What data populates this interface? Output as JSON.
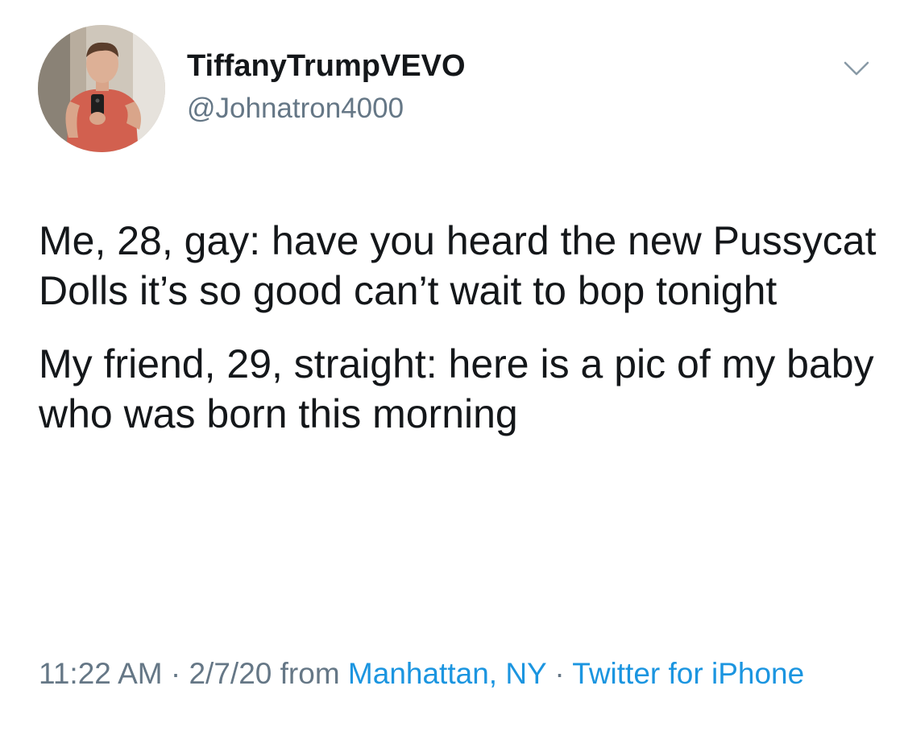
{
  "user": {
    "display_name": "TiffanyTrumpVEVO",
    "handle": "@Johnatron4000",
    "avatar_icon": "profile-photo"
  },
  "tweet": {
    "paragraphs": [
      "Me, 28, gay: have you heard the new Pussycat Dolls it’s so good can’t wait to bop tonight",
      "My friend, 29, straight: here is a pic of my baby who was born this morning"
    ]
  },
  "meta": {
    "time": "11:22 AM",
    "sep1": " · ",
    "date": "2/7/20",
    "from": " from ",
    "location": "Manhattan, NY",
    "sep2": " · ",
    "source": "Twitter for iPhone"
  },
  "menu_icon": "chevron-down-icon",
  "colors": {
    "text": "#14171a",
    "secondary": "#657786",
    "link": "#1b95e0"
  }
}
